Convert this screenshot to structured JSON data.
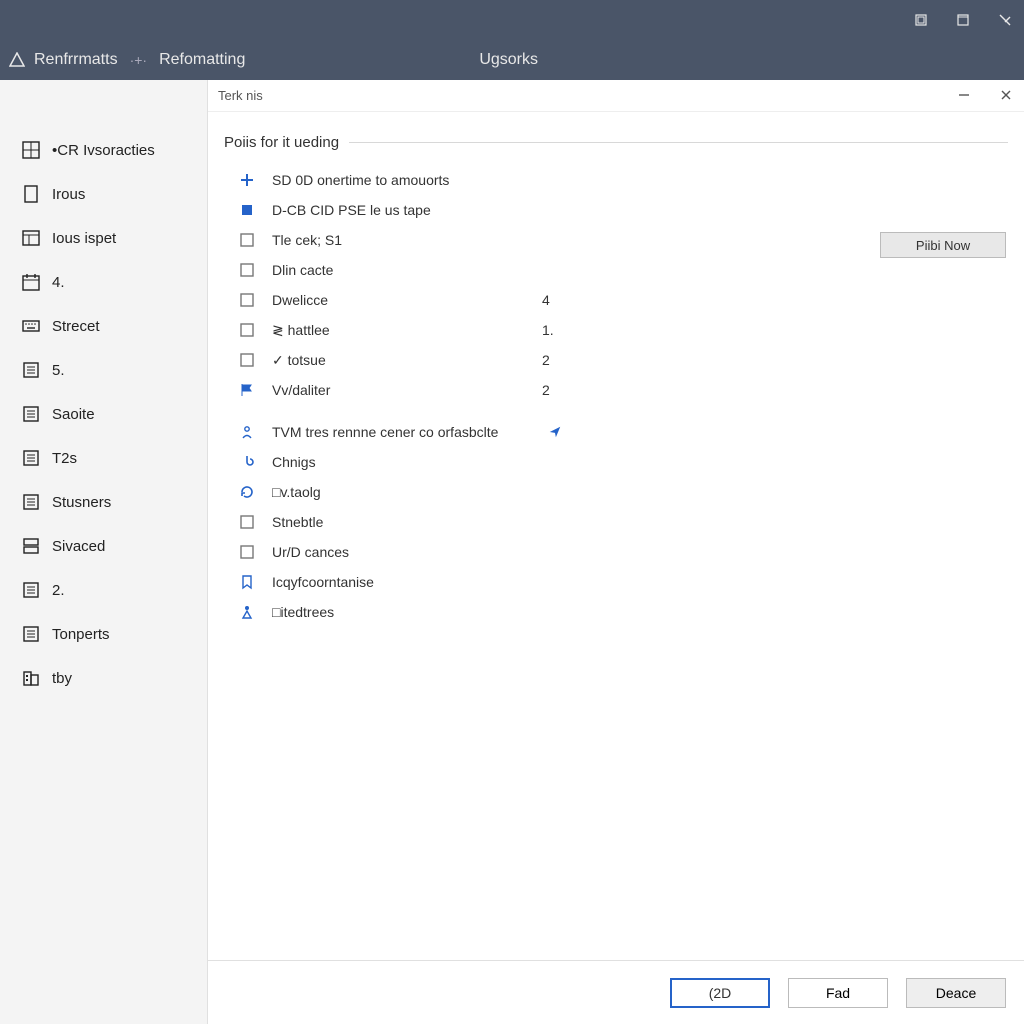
{
  "titlebar": {
    "window_controls": [
      "minimize",
      "maximize",
      "close"
    ]
  },
  "menubar": {
    "app_name": "Renfrrmatts",
    "breadcrumb": "Refomatting",
    "center_label": "Ugsorks"
  },
  "sidebar": {
    "items": [
      {
        "icon": "grid-icon",
        "label": "•CR Ivsoracties"
      },
      {
        "icon": "page-icon",
        "label": "Irous"
      },
      {
        "icon": "panel-icon",
        "label": "Ious ispet"
      },
      {
        "icon": "date-icon",
        "label": "4."
      },
      {
        "icon": "keyboard-icon",
        "label": "Strecet"
      },
      {
        "icon": "list-icon",
        "label": "5."
      },
      {
        "icon": "list-icon",
        "label": "Saoite"
      },
      {
        "icon": "list-icon",
        "label": "T2s"
      },
      {
        "icon": "list-icon",
        "label": "Stusners"
      },
      {
        "icon": "stack-icon",
        "label": "Sivaced"
      },
      {
        "icon": "list-icon",
        "label": "2."
      },
      {
        "icon": "list-icon",
        "label": "Tonperts"
      },
      {
        "icon": "building-icon",
        "label": "tby"
      }
    ]
  },
  "panel": {
    "tab_label": "Terk nis",
    "section_title": "Poiis for it ueding",
    "rows": [
      {
        "icon": "plus-icon",
        "icon_color": "blue",
        "label": "SD 0D onertime to amouorts",
        "value": ""
      },
      {
        "icon": "box-icon",
        "icon_color": "blue",
        "label": "D-CB CID PSE le us tape",
        "value": ""
      },
      {
        "icon": "square-icon",
        "icon_color": "grey",
        "label": "Tle cek; S1",
        "value": ""
      },
      {
        "icon": "square-icon",
        "icon_color": "grey",
        "label": "Dlin cacte",
        "value": ""
      },
      {
        "icon": "square-icon",
        "icon_color": "grey",
        "label": "Dwelicce",
        "value": "4"
      },
      {
        "icon": "checkbox-icon",
        "icon_color": "grey",
        "label": "≷ hattlee",
        "value": "1."
      },
      {
        "icon": "checkbox-icon",
        "icon_color": "grey",
        "label": "✓ totsue",
        "value": "2"
      },
      {
        "icon": "flag-icon",
        "icon_color": "blue",
        "label": "Vv/daliter",
        "value": "2"
      },
      {
        "icon": "person-icon",
        "icon_color": "blue",
        "label": "TVM tres rennne cener co orfasbclte",
        "value": "",
        "trailing_icon": "send-icon"
      },
      {
        "icon": "hook-icon",
        "icon_color": "blue",
        "label": "Chnigs",
        "value": ""
      },
      {
        "icon": "refresh-icon",
        "icon_color": "blue",
        "label": "□v.taolg",
        "value": ""
      },
      {
        "icon": "square-icon",
        "icon_color": "grey",
        "label": "Stnebtle",
        "value": ""
      },
      {
        "icon": "checkbox-icon",
        "icon_color": "grey",
        "label": "Ur/D cances",
        "value": ""
      },
      {
        "icon": "bookmark-icon",
        "icon_color": "blue",
        "label": "Icqyfcoorntanise",
        "value": ""
      },
      {
        "icon": "person2-icon",
        "icon_color": "blue",
        "label": "□itedtrees",
        "value": ""
      }
    ],
    "right_button": "Piibi Now"
  },
  "footer": {
    "primary": "(2D",
    "secondary": "Fad",
    "tertiary": "Deace"
  }
}
